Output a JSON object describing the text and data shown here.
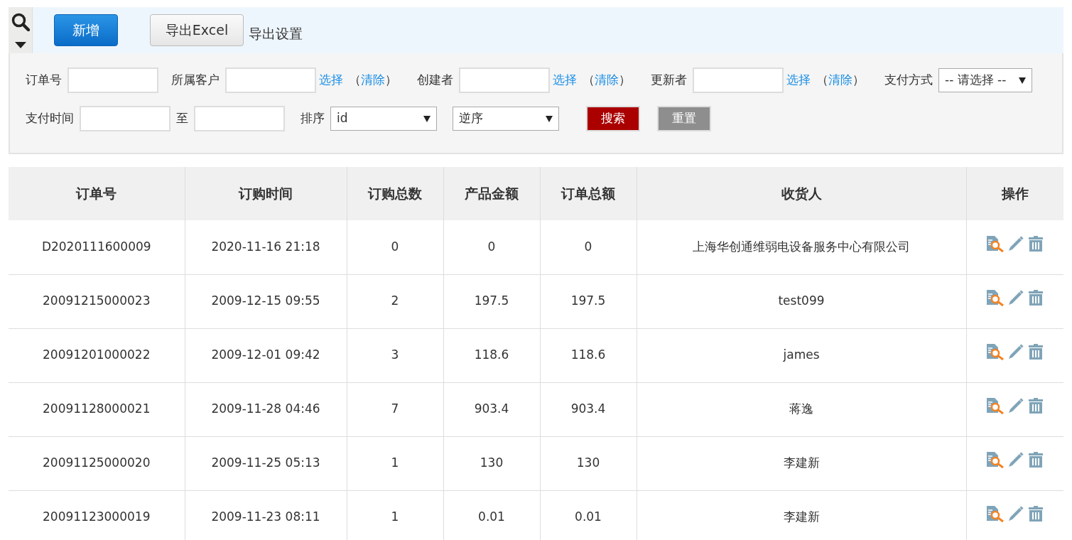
{
  "toolbar": {
    "add_button": "新增",
    "export_button": "导出Excel",
    "export_settings": "导出设置"
  },
  "filters": {
    "rows": [
      [
        {
          "kind": "input",
          "label": "订单号"
        },
        {
          "kind": "picker",
          "label": "所属客户",
          "select": "选择",
          "paren_open": "（",
          "clear": "清除",
          "paren_close": "）"
        },
        {
          "kind": "picker",
          "label": "创建者",
          "select": "选择",
          "paren_open": "（",
          "clear": "清除",
          "paren_close": "）"
        },
        {
          "kind": "picker",
          "label": "更新者",
          "select": "选择",
          "paren_open": "（",
          "clear": "清除",
          "paren_close": "）"
        },
        {
          "kind": "select",
          "label": "支付方式",
          "value": "-- 请选择 --"
        }
      ],
      [
        {
          "kind": "range",
          "label": "支付时间",
          "separator": "至"
        },
        {
          "kind": "select",
          "label": "排序",
          "value": "id"
        },
        {
          "kind": "select",
          "value": "逆序"
        }
      ]
    ],
    "search_button": "搜索",
    "reset_button": "重置"
  },
  "table": {
    "columns": [
      "订单号",
      "订购时间",
      "订购总数",
      "产品金额",
      "订单总额",
      "收货人",
      "操作"
    ],
    "rows": [
      [
        "D2020111600009",
        "2020-11-16 21:18",
        "0",
        "0",
        "0",
        "上海华创通维弱电设备服务中心有限公司"
      ],
      [
        "20091215000023",
        "2009-12-15 09:55",
        "2",
        "197.5",
        "197.5",
        "test099"
      ],
      [
        "20091201000022",
        "2009-12-01 09:42",
        "3",
        "118.6",
        "118.6",
        "james"
      ],
      [
        "20091128000021",
        "2009-11-28 04:46",
        "7",
        "903.4",
        "903.4",
        "蒋逸"
      ],
      [
        "20091125000020",
        "2009-11-25 05:13",
        "1",
        "130",
        "130",
        "李建新"
      ],
      [
        "20091123000019",
        "2009-11-23 08:11",
        "1",
        "0.01",
        "0.01",
        "李建新"
      ]
    ]
  }
}
